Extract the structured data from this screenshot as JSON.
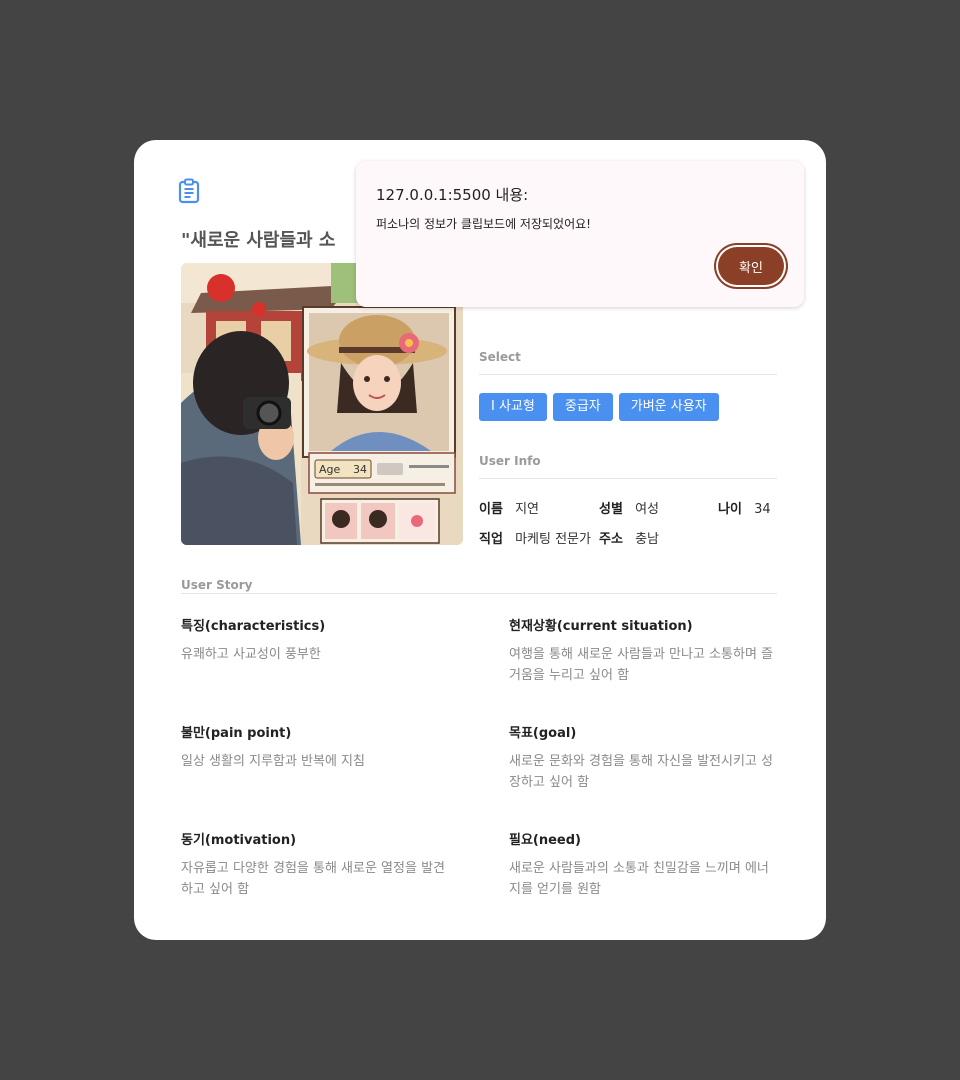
{
  "persona": {
    "title": "\"새로운 사람들과 소",
    "select_label": "Select",
    "tags": [
      "I 사교형",
      "중급자",
      "가벼운 사용자"
    ],
    "user_info_label": "User Info",
    "info": {
      "name_label": "이름",
      "name": "지연",
      "gender_label": "성별",
      "gender": "여성",
      "age_label": "나이",
      "age": "34",
      "job_label": "직업",
      "job": "마케팅 전문가",
      "address_label": "주소",
      "address": "충남"
    }
  },
  "photo": {
    "age_label": "Age",
    "age_value": "34"
  },
  "story": {
    "label": "User Story",
    "items": [
      {
        "title": "특징(characteristics)",
        "text": "유쾌하고 사교성이 풍부한"
      },
      {
        "title": "현재상황(current situation)",
        "text": "여행을 통해 새로운 사람들과 만나고 소통하며 즐거움을 누리고 싶어 함"
      },
      {
        "title": "불만(pain point)",
        "text": "일상 생활의 지루함과 반복에 지침"
      },
      {
        "title": "목표(goal)",
        "text": "새로운 문화와 경험을 통해 자신을 발전시키고 성장하고 싶어 함"
      },
      {
        "title": "동기(motivation)",
        "text": "자유롭고 다양한 경험을 통해 새로운 열정을 발견하고 싶어 함"
      },
      {
        "title": "필요(need)",
        "text": "새로운 사람들과의 소통과 친밀감을 느끼며 에너지를 얻기를 원함"
      }
    ]
  },
  "alert": {
    "origin": "127.0.0.1:5500 내용:",
    "message": "퍼소나의 정보가 클립보드에 저장되었어요!",
    "ok_label": "확인"
  },
  "colors": {
    "backdrop": "#444444",
    "tag": "#4a90f0",
    "ok_button": "#8b3f27",
    "icon": "#4a90f0"
  },
  "icons": {
    "copy": "clipboard-icon"
  }
}
